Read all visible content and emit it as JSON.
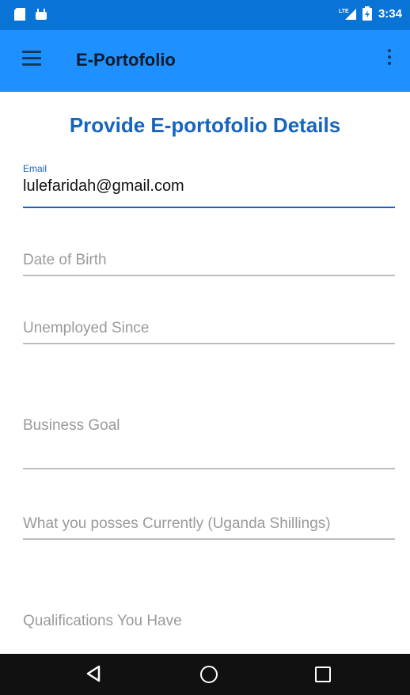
{
  "status_bar": {
    "time": "3:34",
    "icons": [
      "sd-card-icon",
      "android-icon",
      "lte-signal-icon",
      "battery-icon"
    ]
  },
  "app_bar": {
    "title": "E-Portofolio"
  },
  "form": {
    "title": "Provide E-portofolio Details",
    "email": {
      "label": "Email",
      "value": "lulefaridah@gmail.com"
    },
    "date_of_birth": {
      "placeholder": "Date of Birth"
    },
    "unemployed_since": {
      "placeholder": "Unemployed Since"
    },
    "business_goal": {
      "placeholder": "Business Goal"
    },
    "current_possessions": {
      "placeholder": "What you posses Currently (Uganda Shillings)"
    },
    "qualifications": {
      "placeholder": "Qualifications You Have"
    }
  },
  "colors": {
    "status_bar": "#0a73d6",
    "app_bar": "#1e90ff",
    "accent": "#1565c0",
    "nav_bar": "#111111"
  }
}
